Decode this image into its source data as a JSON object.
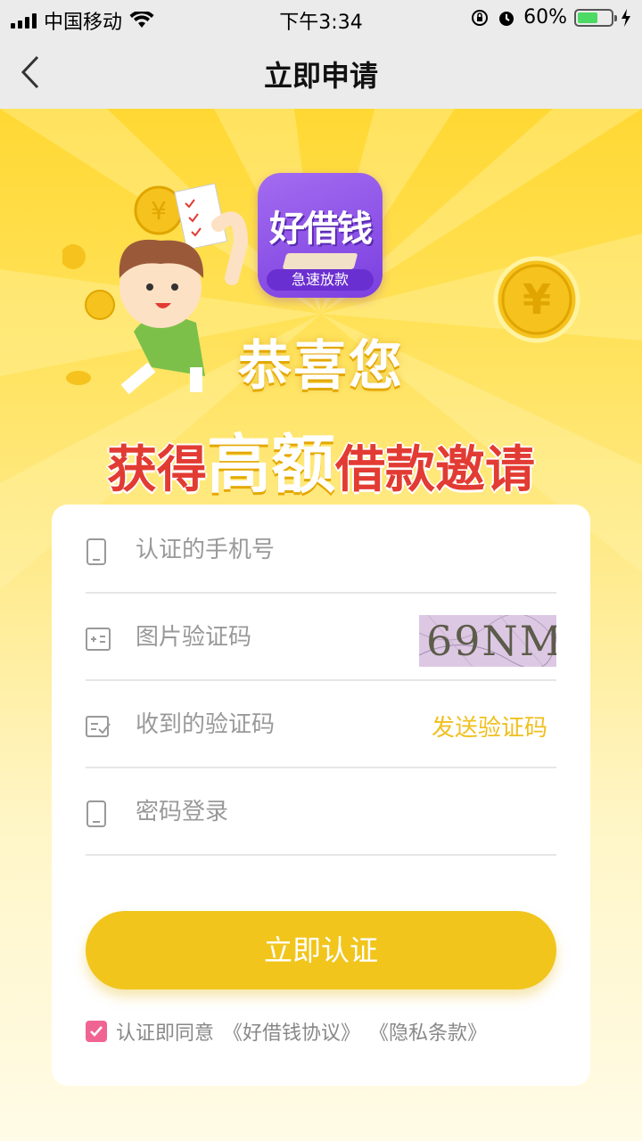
{
  "status_bar": {
    "carrier": "中国移动",
    "time": "下午3:34",
    "battery_percent_label": "60%",
    "battery_level": 0.6,
    "icons": [
      "signal-icon",
      "wifi-icon",
      "orientation-lock-icon",
      "alarm-icon",
      "battery-icon",
      "charging-icon"
    ]
  },
  "nav": {
    "title": "立即申请",
    "back_icon": "chevron-left-icon"
  },
  "hero": {
    "app_name": "好借钱",
    "app_tagline": "急速放款",
    "headline_line1": "恭喜您",
    "headline_part1": "获得",
    "headline_part2": "高额",
    "headline_part3": "借款邀请"
  },
  "form": {
    "phone_placeholder": "认证的手机号",
    "captcha_placeholder": "图片验证码",
    "captcha_text": "69NM",
    "sms_placeholder": "收到的验证码",
    "send_code_label": "发送验证码",
    "password_placeholder": "密码登录",
    "submit_label": "立即认证",
    "agree_text": "认证即同意",
    "agreement_link": "《好借钱协议》",
    "privacy_link": "《隐私条款》"
  },
  "colors": {
    "accent": "#f1c51c",
    "headline_red": "#e23b33",
    "checkbox": "#f06493",
    "app_logo": "#8a4ee8"
  }
}
